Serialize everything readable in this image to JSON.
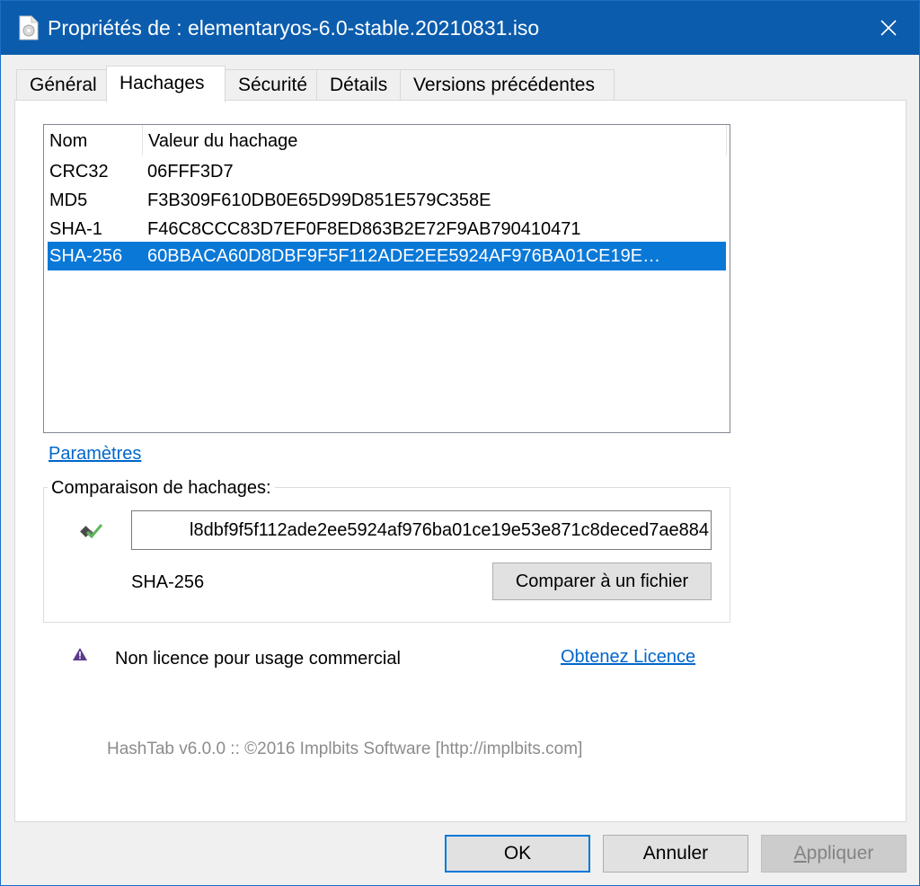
{
  "window": {
    "title": "Propriétés de : elementaryos-6.0-stable.20210831.iso",
    "close_icon": "close-icon",
    "file_icon": "file-icon"
  },
  "tabs": [
    {
      "label": "Général",
      "active": false
    },
    {
      "label": "Hachages",
      "active": true
    },
    {
      "label": "Sécurité",
      "active": false
    },
    {
      "label": "Détails",
      "active": false
    },
    {
      "label": "Versions précédentes",
      "active": false
    }
  ],
  "hash_list": {
    "columns": [
      "Nom",
      "Valeur du hachage"
    ],
    "rows": [
      {
        "name": "CRC32",
        "value": "06FFF3D7",
        "selected": false
      },
      {
        "name": "MD5",
        "value": "F3B309F610DB0E65D99D851E579C358E",
        "selected": false
      },
      {
        "name": "SHA-1",
        "value": "F46C8CCC83D7EF0F8ED863B2E72F9AB790410471",
        "selected": false
      },
      {
        "name": "SHA-256",
        "value": "60BBACA60D8DBF9F5F112ADE2EE5924AF976BA01CE19E…",
        "selected": true
      }
    ]
  },
  "settings_link": "Paramètres",
  "comparison": {
    "group_label": "Comparaison de hachages:",
    "input_value": "l8dbf9f5f112ade2ee5924af976ba01ce19e53e871c8deced7ae884",
    "algorithm": "SHA-256",
    "compare_button": "Comparer à un fichier",
    "status_icon": "verified-check-icon"
  },
  "license": {
    "warning_text": "Non licence pour usage commercial",
    "link": "Obtenez Licence",
    "icon": "warning-icon"
  },
  "footer": "HashTab v6.0.0 :: ©2016 Implbits Software [http://implbits.com]",
  "buttons": {
    "ok": "OK",
    "cancel": "Annuler",
    "apply_first": "A",
    "apply_rest": "ppliquer"
  },
  "colors": {
    "title_bar": "#0b5cad",
    "selection": "#0a78d7",
    "link": "#0066cc",
    "warning_icon": "#5b3a8c",
    "check_icon": "#5cb85c"
  }
}
